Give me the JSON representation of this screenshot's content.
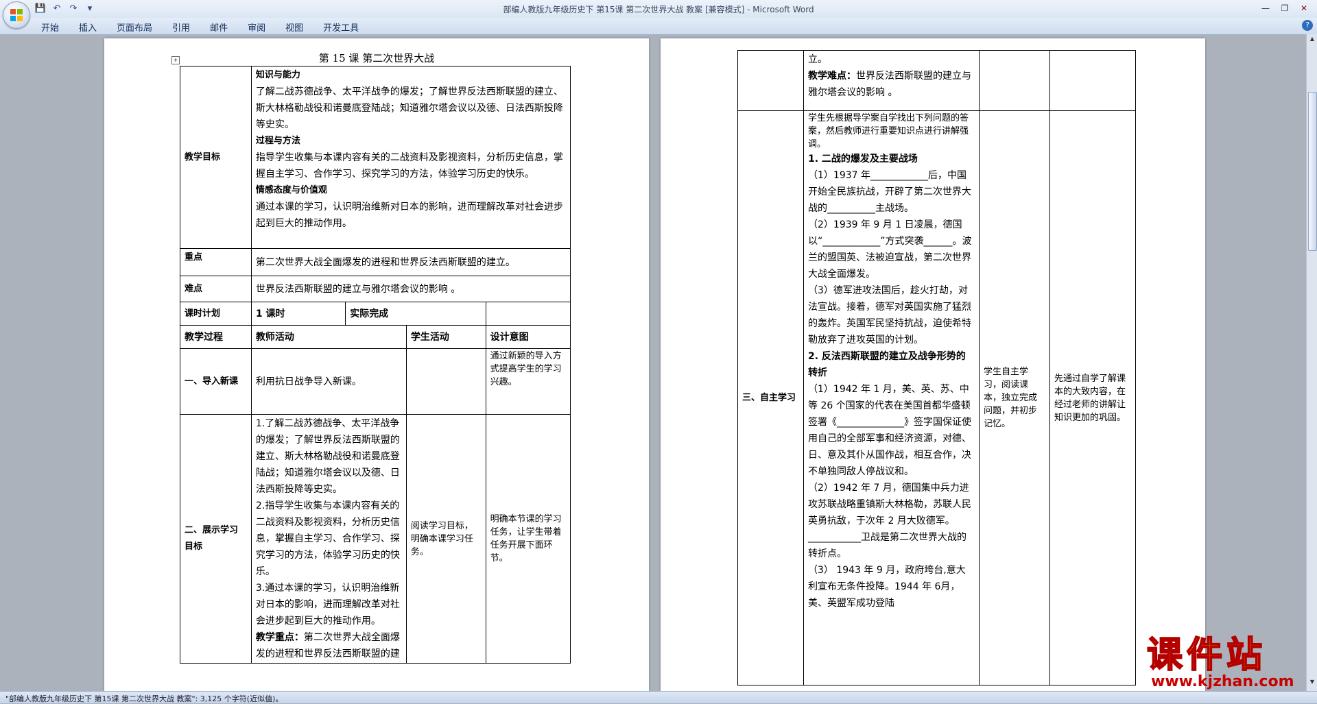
{
  "window": {
    "title": "部编人教版九年级历史下 第15课 第二次世界大战 教案 [兼容模式] - Microsoft Word",
    "accent": "#2f6bbd"
  },
  "menu": [
    "开始",
    "插入",
    "页面布局",
    "引用",
    "邮件",
    "审阅",
    "视图",
    "开发工具"
  ],
  "status": "\"部编人教版九年级历史下 第15课 第二次世界大战 教案\": 3,125 个字符(近似值)。",
  "watermark": {
    "title": "课件站",
    "url": "www.kjzhan.com"
  },
  "page1": {
    "title": "第 15 课    第二次世界大战",
    "goals_label": "教学目标",
    "goals_h1": "知识与能力",
    "goals_t1": "了解二战苏德战争、太平洋战争的爆发；了解世界反法西斯联盟的建立、斯大林格勒战役和诺曼底登陆战；知道雅尔塔会议以及德、日法西斯投降等史实。",
    "goals_h2": "过程与方法",
    "goals_t2": "指导学生收集与本课内容有关的二战资料及影视资料，分析历史信息，掌握自主学习、合作学习、探究学习的方法，体验学习历史的快乐。",
    "goals_h3": "情感态度与价值观",
    "goals_t3": "通过本课的学习，认识明治维新对日本的影响，进而理解改革对社会进步起到巨大的推动作用。",
    "key_label": "重点",
    "key_text": "第二次世界大战全面爆发的进程和世界反法西斯联盟的建立。",
    "diff_label": "难点",
    "diff_text": "世界反法西斯联盟的建立与雅尔塔会议的影响 。",
    "plan_label": "课时计划",
    "plan_value": "1 课时",
    "actual_label": "实际完成",
    "h_process": "教学过程",
    "h_teacher": "教师活动",
    "h_student": "学生活动",
    "h_design": "设计意图",
    "r1_label": "一、导入新课",
    "r1_teacher": "利用抗日战争导入新课。",
    "r1_design": "通过新颖的导入方式提高学生的学习兴趣。",
    "r2_label": "二、展示学习目标",
    "r2_t1": "1.了解二战苏德战争、太平洋战争的爆发；了解世界反法西斯联盟的建立、斯大林格勒战役和诺曼底登陆战；知道雅尔塔会议以及德、日法西斯投降等史实。",
    "r2_t2": "2.指导学生收集与本课内容有关的二战资料及影视资料，分析历史信息，掌握自主学习、合作学习、探究学习的方法，体验学习历史的快乐。",
    "r2_t3": "3.通过本课的学习，认识明治维新对日本的影响，进而理解改革对社会进步起到巨大的推动作用。",
    "r2_key_label": "教学重点：",
    "r2_key_text": "第二次世界大战全面爆发的进程和世界反法西斯联盟的建",
    "r2_student": "阅读学习目标，明确本课学习任务。",
    "r2_design": "明确本节课的学习任务，让学生带着任务开展下面环节。"
  },
  "page2": {
    "cont_text": "立。",
    "diff_label": "教学难点：",
    "diff_text": "世界反法西斯联盟的建立与雅尔塔会议的影响 。",
    "r3_label": "三、自主学习",
    "intro": "学生先根据导学案自学找出下列问题的答案，然后教师进行重要知识点进行讲解强调。",
    "h1": "1. 二战的爆发及主要战场",
    "q1": "（1）1937 年____________后，中国开始全民族抗战，开辟了第二次世界大战的__________主战场。",
    "q2": "（2）1939 年 9 月 1 日凌晨，德国以“____________”方式突袭______。波兰的盟国英、法被迫宣战，第二次世界大战全面爆发。",
    "q3": "（3）德军进攻法国后，趁火打劫，对法宣战。接着，德军对英国实施了猛烈的轰炸。英国军民坚持抗战，迫使希特勒放弃了进攻英国的计划。",
    "h2": "2. 反法西斯联盟的建立及战争形势的转折",
    "q4": "（1）1942 年 1 月，美、英、苏、中等 26 个国家的代表在美国首都华盛顿签署《______________》签字国保证使用自己的全部军事和经济资源，对德、日、意及其仆从国作战，相互合作，决不单独同敌人停战议和。",
    "q5": "（2）1942 年 7 月，德国集中兵力进攻苏联战略重镇斯大林格勒，苏联人民英勇抗敌，于次年 2 月大败德军。___________卫战是第二次世界大战的转折点。",
    "q6": "（3） 1943 年 9 月，政府垮台,意大利宣布无条件投降。1944 年 6月，美、英盟军成功登陆",
    "r3_student": "学生自主学习，阅读课本，独立完成问题，并初步记忆。",
    "r3_design": "先通过自学了解课本的大致内容，在经过老师的讲解让知识更加的巩固。"
  }
}
